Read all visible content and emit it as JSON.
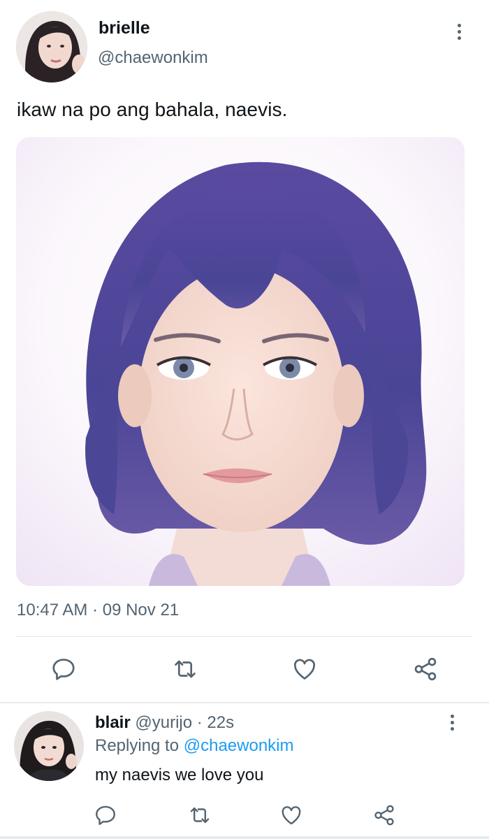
{
  "tweet": {
    "author_name": "brielle",
    "author_handle": "@chaewonkim",
    "text": "ikaw na po ang bahala, naevis.",
    "timestamp": "10:47 AM · 09 Nov 21",
    "actions": [
      "reply-icon",
      "retweet-icon",
      "like-icon",
      "share-icon"
    ]
  },
  "reply": {
    "author_name": "blair",
    "author_handle": "@yurijo",
    "separator": " · ",
    "age": "22s",
    "replying_to_label": "Replying to",
    "replying_to_handle": "@chaewonkim",
    "text": "my naevis we love you",
    "actions": [
      "reply-icon",
      "retweet-icon",
      "like-icon",
      "share-icon"
    ]
  },
  "colors": {
    "text_primary": "#0f1419",
    "text_secondary": "#536471",
    "link": "#1d9bf0",
    "divider": "#e1e6ea",
    "hair_accent": "#5b4f9c"
  }
}
